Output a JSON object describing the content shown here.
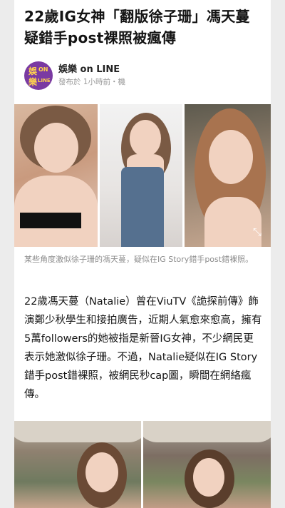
{
  "article": {
    "title": "22歲IG女神「翻版徐子珊」馮天蔓疑錯手post裸照被瘋傳",
    "publisher": {
      "logo_text": [
        "娛",
        "ON",
        "樂",
        "LINE"
      ],
      "name": "娛樂 on LINE",
      "meta": "發布於 1小時前・機"
    },
    "image_caption": "某些角度激似徐子珊的馮天蔓，疑似在IG Story錯手post錯裸照。",
    "body": "22歲馮天蔓（Natalie）曾在ViuTV《詭探前傳》飾演鄭少秋學生和接拍廣告，近期人氣愈來愈高，擁有5萬followers的她被指是新晉IG女神，不少網民更表示她激似徐子珊。不過，Natalie疑似在IG Story錯手post錯裸照，被網民秒cap圖，瞬間在網絡瘋傳。",
    "icons": {
      "expand": "expand-icon"
    }
  }
}
